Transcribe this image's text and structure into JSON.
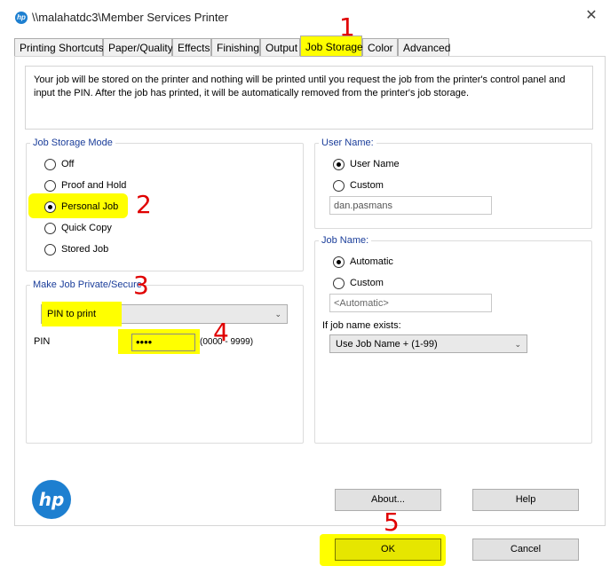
{
  "window": {
    "title": "\\\\malahatdc3\\Member Services Printer",
    "close_glyph": "✕"
  },
  "tabs": [
    {
      "label": "Printing Shortcuts"
    },
    {
      "label": "Paper/Quality"
    },
    {
      "label": "Effects"
    },
    {
      "label": "Finishing"
    },
    {
      "label": "Output"
    },
    {
      "label": "Job Storage"
    },
    {
      "label": "Color"
    },
    {
      "label": "Advanced"
    }
  ],
  "description": "Your job will be stored on the printer and nothing will be printed until you request the job from the printer's control panel and input the PIN. After the job has printed, it will be automatically removed from the printer's job storage.",
  "job_storage_mode": {
    "title": "Job Storage Mode",
    "options": [
      "Off",
      "Proof and Hold",
      "Personal Job",
      "Quick Copy",
      "Stored Job"
    ],
    "selected": "Personal Job"
  },
  "make_private": {
    "title": "Make Job Private/Secure",
    "selected": "PIN to print",
    "pin_label": "PIN",
    "pin_value": "••••",
    "pin_range": "(0000 - 9999)"
  },
  "user_name": {
    "title": "User Name:",
    "options": [
      "User Name",
      "Custom"
    ],
    "selected": "User Name",
    "value": "dan.pasmans"
  },
  "job_name": {
    "title": "Job Name:",
    "options": [
      "Automatic",
      "Custom"
    ],
    "selected": "Automatic",
    "placeholder": "<Automatic>",
    "exists_label": "If job name exists:",
    "exists_value": "Use Job Name + (1-99)"
  },
  "buttons": {
    "about": "About...",
    "help": "Help",
    "ok": "OK",
    "cancel": "Cancel"
  },
  "logo": {
    "text": "hp"
  },
  "annotations": [
    "1",
    "2",
    "3",
    "4",
    "5"
  ],
  "colors": {
    "highlight": "#ffff00",
    "annotation": "#e00000",
    "group_title": "#1a3d9a",
    "hp_blue": "#1d7fd0"
  }
}
